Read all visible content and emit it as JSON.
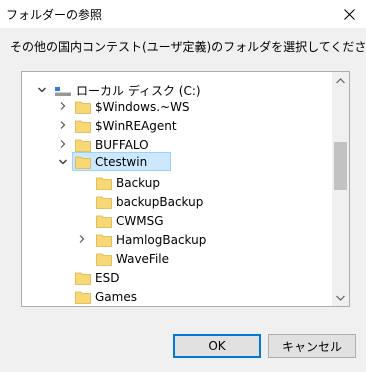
{
  "dialog": {
    "title": "フォルダーの参照",
    "description": "その他の国内コンテスト(ユーザ定義)のフォルダを選択してください"
  },
  "tree": {
    "root": {
      "label": "ローカル ディスク (C:)",
      "icon": "drive-icon",
      "expanded": true
    },
    "items": [
      {
        "label": "$Windows.~WS",
        "expandable": true
      },
      {
        "label": "$WinREAgent",
        "expandable": true
      },
      {
        "label": "BUFFALO",
        "expandable": true
      },
      {
        "label": "Ctestwin",
        "expandable": true,
        "expanded": true,
        "selected": true,
        "children": [
          {
            "label": "Backup",
            "expandable": false
          },
          {
            "label": "backupBackup",
            "expandable": false
          },
          {
            "label": "CWMSG",
            "expandable": false
          },
          {
            "label": "HamlogBackup",
            "expandable": true
          },
          {
            "label": "WaveFile",
            "expandable": false
          }
        ]
      },
      {
        "label": "ESD",
        "expandable": false
      },
      {
        "label": "Games",
        "expandable": false
      }
    ]
  },
  "buttons": {
    "ok": "OK",
    "cancel": "キャンセル"
  },
  "colors": {
    "selection": "#cce8ff",
    "selection_border": "#99d1ff",
    "folder": "#f8d775",
    "focus": "#0078d7"
  }
}
